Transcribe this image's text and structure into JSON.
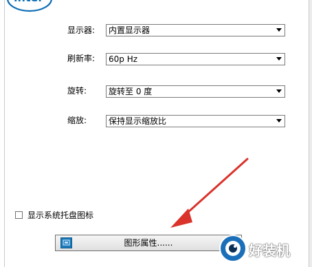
{
  "brand": {
    "logo_text": "intel"
  },
  "settings": {
    "display": {
      "label": "显示器:",
      "value": "内置显示器"
    },
    "refresh": {
      "label": "刷新率:",
      "value": "60p Hz"
    },
    "rotation": {
      "label": "旋转:",
      "value": "旋转至 0 度"
    },
    "scaling": {
      "label": "缩放:",
      "value": "保持显示缩放比"
    }
  },
  "tray_checkbox": {
    "label": "显示系统托盘图标",
    "checked": false
  },
  "graphics_button": {
    "label": "图形属性......"
  },
  "watermark": {
    "text": "好装机"
  },
  "colors": {
    "arrow": "#d9332b",
    "intel_blue": "#0f6fb5",
    "button_icon": "#1b78b8"
  }
}
